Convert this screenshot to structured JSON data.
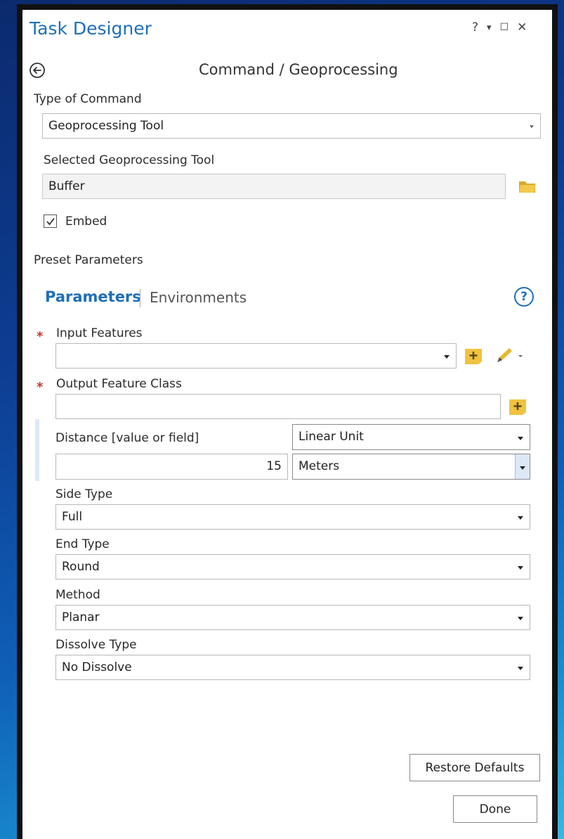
{
  "window": {
    "title": "Task Designer",
    "controls": {
      "help": "?",
      "pin": "▾",
      "maximize": "☐",
      "close": "✕"
    }
  },
  "header": {
    "title": "Command / Geoprocessing"
  },
  "command": {
    "type_label": "Type of Command",
    "type_value": "Geoprocessing Tool",
    "tool_label": "Selected Geoprocessing Tool",
    "tool_value": "Buffer",
    "embed_label": "Embed",
    "embed_checked": true
  },
  "preset": {
    "label": "Preset Parameters",
    "tabs": [
      {
        "label": "Parameters",
        "active": true
      },
      {
        "label": "Environments",
        "active": false
      }
    ],
    "help": "?"
  },
  "params": {
    "input_features_label": "Input Features",
    "input_features_value": "",
    "output_class_label": "Output Feature Class",
    "output_class_value": "",
    "distance_label": "Distance [value or field]",
    "distance_mode": "Linear Unit",
    "distance_value": "15",
    "distance_unit": "Meters",
    "side_type_label": "Side Type",
    "side_type_value": "Full",
    "end_type_label": "End Type",
    "end_type_value": "Round",
    "method_label": "Method",
    "method_value": "Planar",
    "dissolve_label": "Dissolve Type",
    "dissolve_value": "No Dissolve"
  },
  "buttons": {
    "restore": "Restore Defaults",
    "done": "Done"
  },
  "colors": {
    "accent": "#1e6fb8",
    "required": "#c0392b",
    "folder": "#f0c240"
  }
}
